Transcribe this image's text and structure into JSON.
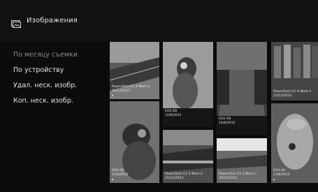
{
  "header": {
    "title": "Изображения",
    "icon": "gallery-icon"
  },
  "menu": [
    {
      "label": "По месяцу съемки",
      "dim": true
    },
    {
      "label": "По устройству",
      "dim": false
    },
    {
      "label": "Удал. неск. изобр.",
      "dim": false
    },
    {
      "label": "Коп. неск. изобр.",
      "dim": false
    }
  ],
  "tiles": [
    {
      "camera": "PowerShot G1 X Mark II",
      "date": "21/12/2013"
    },
    {
      "camera": "",
      "date": ""
    },
    {
      "camera": "",
      "date": ""
    },
    {
      "camera": "PowerShot G1 X Mark II",
      "date": "21/12/2013"
    },
    {
      "camera": "EOS 6D",
      "date": "12/8/2012"
    },
    {
      "camera": "EOS 6D",
      "date": "14/8/2012"
    },
    {
      "camera": "EOS 6D",
      "date": "12/8/2012"
    },
    {
      "camera": "PowerShot G1 X Mark II",
      "date": "21/12/2013"
    },
    {
      "camera": "PowerShot G1 X Mark II",
      "date": "18/12/2013"
    },
    {
      "camera": "EOS 6D",
      "date": "13/8/2012"
    }
  ]
}
